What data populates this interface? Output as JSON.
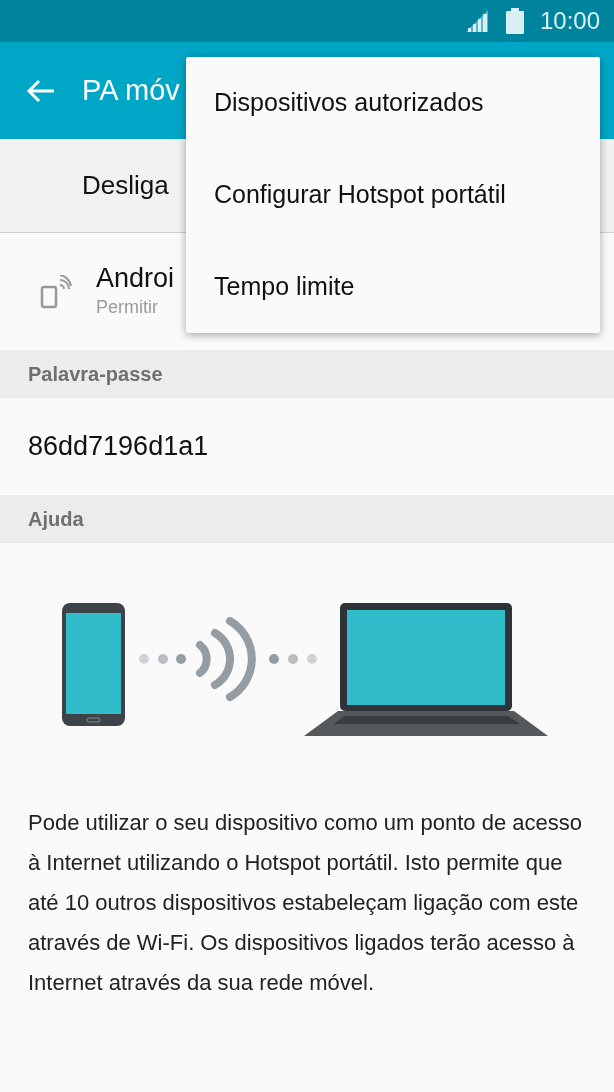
{
  "status_bar": {
    "time": "10:00"
  },
  "app_bar": {
    "title": "PA móv"
  },
  "master_switch": {
    "label": "Desliga"
  },
  "network": {
    "name": "Androi",
    "subtitle": "Permitir"
  },
  "sections": [
    {
      "header": "Palavra-passe",
      "value": "86dd7196d1a1"
    },
    {
      "header": "Ajuda"
    }
  ],
  "help_text": "Pode utilizar o seu dispositivo como um ponto de acesso à Internet utilizando o Hotspot portátil. Isto permite que até 10 outros dispositivos estabeleçam ligação com este através de Wi-Fi. Os dispositivos ligados terão acesso à Internet através da sua rede móvel.",
  "menu": [
    {
      "label": "Dispositivos autorizados"
    },
    {
      "label": "Configurar Hotspot portátil"
    },
    {
      "label": "Tempo limite"
    }
  ]
}
